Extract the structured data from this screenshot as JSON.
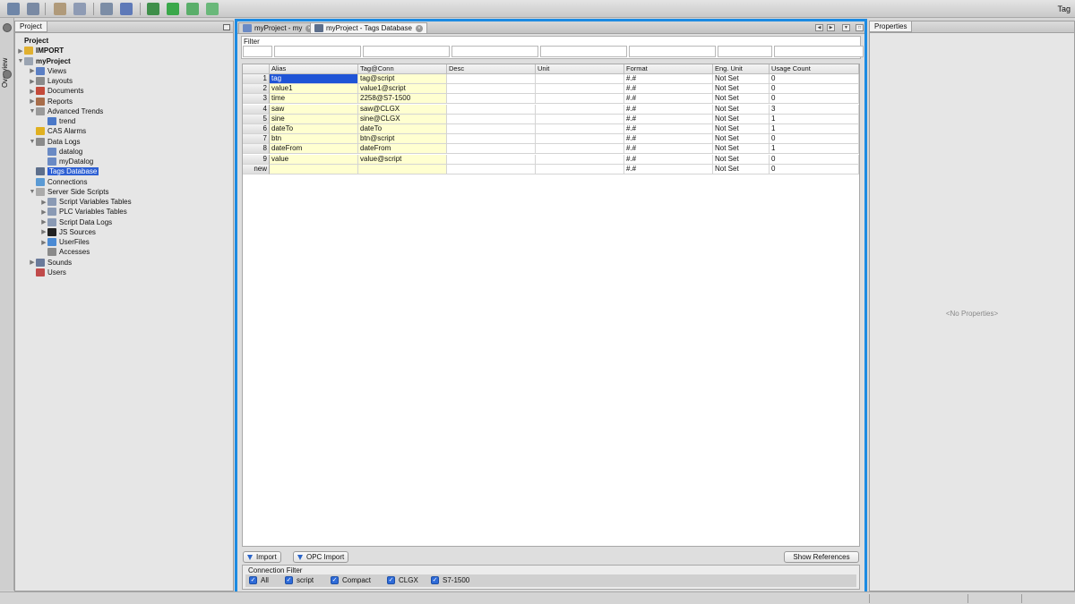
{
  "toolbar": {
    "right_label": "Tag"
  },
  "overview": {
    "label": "Overview"
  },
  "project_panel": {
    "tab": "Project",
    "tree": [
      {
        "label": "Project",
        "depth": 0,
        "bold": true,
        "arrow": "",
        "icon": "",
        "color": ""
      },
      {
        "label": "IMPORT",
        "depth": 0,
        "bold": true,
        "arrow": "▶",
        "icon": "folder-icon",
        "color": "#e0b030"
      },
      {
        "label": "myProject",
        "depth": 0,
        "bold": true,
        "arrow": "▼",
        "icon": "project-icon",
        "color": "#9aa4b2"
      },
      {
        "label": "Views",
        "depth": 1,
        "arrow": "▶",
        "icon": "views-icon",
        "color": "#5b7fc4"
      },
      {
        "label": "Layouts",
        "depth": 1,
        "arrow": "▶",
        "icon": "layouts-icon",
        "color": "#8a8a8a"
      },
      {
        "label": "Documents",
        "depth": 1,
        "arrow": "▶",
        "icon": "documents-icon",
        "color": "#c44a3a"
      },
      {
        "label": "Reports",
        "depth": 1,
        "arrow": "▶",
        "icon": "reports-icon",
        "color": "#a86d4a"
      },
      {
        "label": "Advanced Trends",
        "depth": 1,
        "arrow": "▼",
        "icon": "trends-icon",
        "color": "#9a9a9a"
      },
      {
        "label": "trend",
        "depth": 2,
        "arrow": "",
        "icon": "trend-icon",
        "color": "#4a78c8"
      },
      {
        "label": "CAS Alarms",
        "depth": 1,
        "arrow": "",
        "icon": "alarm-icon",
        "color": "#e0b020"
      },
      {
        "label": "Data Logs",
        "depth": 1,
        "arrow": "▼",
        "icon": "datalogs-icon",
        "color": "#8a8a8a"
      },
      {
        "label": "datalog",
        "depth": 2,
        "arrow": "",
        "icon": "datalog-icon",
        "color": "#6a8ac4"
      },
      {
        "label": "myDatalog",
        "depth": 2,
        "arrow": "",
        "icon": "datalog-icon",
        "color": "#6a8ac4"
      },
      {
        "label": "Tags Database",
        "depth": 1,
        "arrow": "",
        "icon": "database-icon",
        "color": "#5d6f8c",
        "selected": true
      },
      {
        "label": "Connections",
        "depth": 1,
        "arrow": "",
        "icon": "connections-icon",
        "color": "#5a9ad4"
      },
      {
        "label": "Server Side Scripts",
        "depth": 1,
        "arrow": "▼",
        "icon": "scripts-icon",
        "color": "#aaaaaa"
      },
      {
        "label": "Script Variables Tables",
        "depth": 2,
        "arrow": "▶",
        "icon": "table-icon",
        "color": "#8a9ab4"
      },
      {
        "label": "PLC Variables Tables",
        "depth": 2,
        "arrow": "▶",
        "icon": "table-icon",
        "color": "#8a9ab4"
      },
      {
        "label": "Script Data Logs",
        "depth": 2,
        "arrow": "▶",
        "icon": "table-icon",
        "color": "#8a9ab4"
      },
      {
        "label": "JS Sources",
        "depth": 2,
        "arrow": "▶",
        "icon": "js-icon",
        "color": "#222222"
      },
      {
        "label": "UserFiles",
        "depth": 2,
        "arrow": "▶",
        "icon": "userfiles-icon",
        "color": "#4a8ad4"
      },
      {
        "label": "Accesses",
        "depth": 2,
        "arrow": "",
        "icon": "key-icon",
        "color": "#8a8a8a"
      },
      {
        "label": "Sounds",
        "depth": 1,
        "arrow": "▶",
        "icon": "speaker-icon",
        "color": "#6a7a9a"
      },
      {
        "label": "Users",
        "depth": 1,
        "arrow": "",
        "icon": "users-icon",
        "color": "#c04a4a"
      }
    ]
  },
  "editor": {
    "tabs": [
      {
        "label": "myProject - my",
        "active": false
      },
      {
        "label": "myProject - Tags Database",
        "active": true
      }
    ],
    "filter_label": "Filter",
    "columns": [
      "Alias",
      "Tag@Conn",
      "Desc",
      "Unit",
      "Format",
      "Eng. Unit",
      "Usage Count"
    ],
    "rows": [
      {
        "num": "1",
        "alias": "tag",
        "tag": "tag@script",
        "desc": "",
        "unit": "",
        "format": "#.#",
        "eng": "Not Set",
        "usage": "0"
      },
      {
        "num": "2",
        "alias": "value1",
        "tag": "value1@script",
        "desc": "",
        "unit": "",
        "format": "#.#",
        "eng": "Not Set",
        "usage": "0"
      },
      {
        "num": "3",
        "alias": "time",
        "tag": "2258@S7-1500",
        "desc": "",
        "unit": "",
        "format": "#.#",
        "eng": "Not Set",
        "usage": "0"
      },
      {
        "num": "4",
        "alias": "saw",
        "tag": "saw@CLGX",
        "desc": "",
        "unit": "",
        "format": "#.#",
        "eng": "Not Set",
        "usage": "3"
      },
      {
        "num": "5",
        "alias": "sine",
        "tag": "sine@CLGX",
        "desc": "",
        "unit": "",
        "format": "#.#",
        "eng": "Not Set",
        "usage": "1"
      },
      {
        "num": "6",
        "alias": "dateTo",
        "tag": "dateTo",
        "desc": "",
        "unit": "",
        "format": "#.#",
        "eng": "Not Set",
        "usage": "1"
      },
      {
        "num": "7",
        "alias": "btn",
        "tag": "btn@script",
        "desc": "",
        "unit": "",
        "format": "#.#",
        "eng": "Not Set",
        "usage": "0"
      },
      {
        "num": "8",
        "alias": "dateFrom",
        "tag": "dateFrom",
        "desc": "",
        "unit": "",
        "format": "#.#",
        "eng": "Not Set",
        "usage": "1"
      },
      {
        "num": "9",
        "alias": "value",
        "tag": "value@script",
        "desc": "",
        "unit": "",
        "format": "#.#",
        "eng": "Not Set",
        "usage": "0"
      },
      {
        "num": "new",
        "alias": "",
        "tag": "",
        "desc": "",
        "unit": "",
        "format": "#.#",
        "eng": "Not Set",
        "usage": "0"
      }
    ],
    "buttons": {
      "import": "Import",
      "opc_import": "OPC Import",
      "show_references": "Show References"
    },
    "connection_filter": {
      "title": "Connection Filter",
      "items": [
        "All",
        "script",
        "Compact",
        "CLGX",
        "S7-1500"
      ]
    }
  },
  "properties_panel": {
    "tab": "Properties",
    "empty": "<No Properties>"
  },
  "colors": {
    "accent": "#1c8be2",
    "selection": "#1f54d6",
    "tag_cell": "#ffffd0"
  }
}
